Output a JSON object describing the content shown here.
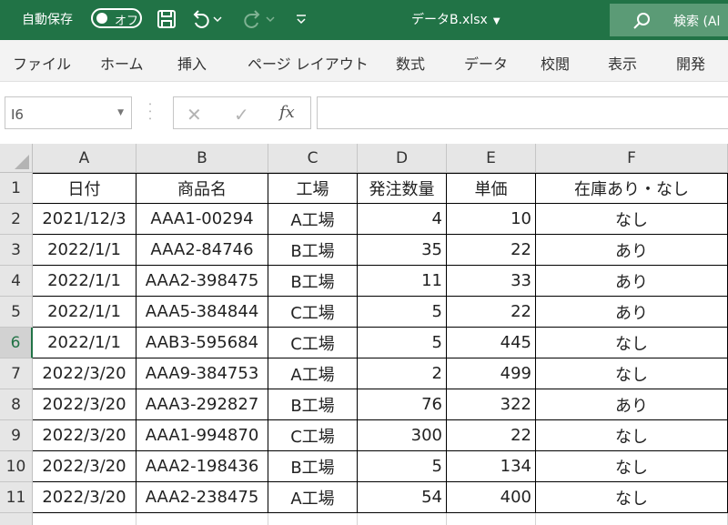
{
  "titlebar": {
    "autosave_label": "自動保存",
    "toggle_state": "オフ",
    "file_name": "データB.xlsx",
    "search_label": "検索 (Al",
    "colors": {
      "bar": "#217346",
      "search": "#5b9b76"
    },
    "icons": [
      "save-icon",
      "undo-icon",
      "redo-icon",
      "customize-toolbar-icon",
      "search-icon"
    ]
  },
  "ribbon": {
    "tabs": [
      "ファイル",
      "ホーム",
      "挿入",
      "ページ レイアウト",
      "数式",
      "データ",
      "校閲",
      "表示",
      "開発"
    ]
  },
  "formula_bar": {
    "name_box": "I6",
    "formula": ""
  },
  "sheet": {
    "columns": [
      "A",
      "B",
      "C",
      "D",
      "E",
      "F"
    ],
    "selected_column": "I",
    "selected_row": "6",
    "rows": [
      {
        "num": "1",
        "cells": [
          "日付",
          "商品名",
          "工場",
          "発注数量",
          "単価",
          "在庫あり・なし"
        ]
      },
      {
        "num": "2",
        "cells": [
          "2021/12/3",
          "AAA1-00294",
          "A工場",
          "4",
          "10",
          "なし"
        ]
      },
      {
        "num": "3",
        "cells": [
          "2022/1/1",
          "AAA2-84746",
          "B工場",
          "35",
          "22",
          "あり"
        ]
      },
      {
        "num": "4",
        "cells": [
          "2022/1/1",
          "AAA2-398475",
          "B工場",
          "11",
          "33",
          "あり"
        ]
      },
      {
        "num": "5",
        "cells": [
          "2022/1/1",
          "AAA5-384844",
          "C工場",
          "5",
          "22",
          "あり"
        ]
      },
      {
        "num": "6",
        "cells": [
          "2022/1/1",
          "AAB3-595684",
          "C工場",
          "5",
          "445",
          "なし"
        ]
      },
      {
        "num": "7",
        "cells": [
          "2022/3/20",
          "AAA9-384753",
          "A工場",
          "2",
          "499",
          "なし"
        ]
      },
      {
        "num": "8",
        "cells": [
          "2022/3/20",
          "AAA3-292827",
          "B工場",
          "76",
          "322",
          "あり"
        ]
      },
      {
        "num": "9",
        "cells": [
          "2022/3/20",
          "AAA1-994870",
          "C工場",
          "300",
          "22",
          "なし"
        ]
      },
      {
        "num": "10",
        "cells": [
          "2022/3/20",
          "AAA2-198436",
          "B工場",
          "5",
          "134",
          "なし"
        ]
      },
      {
        "num": "11",
        "cells": [
          "2022/3/20",
          "AAA2-238475",
          "A工場",
          "54",
          "400",
          "なし"
        ]
      },
      {
        "num": "",
        "cells": [
          "",
          "",
          "",
          "",
          "",
          ""
        ]
      }
    ]
  }
}
